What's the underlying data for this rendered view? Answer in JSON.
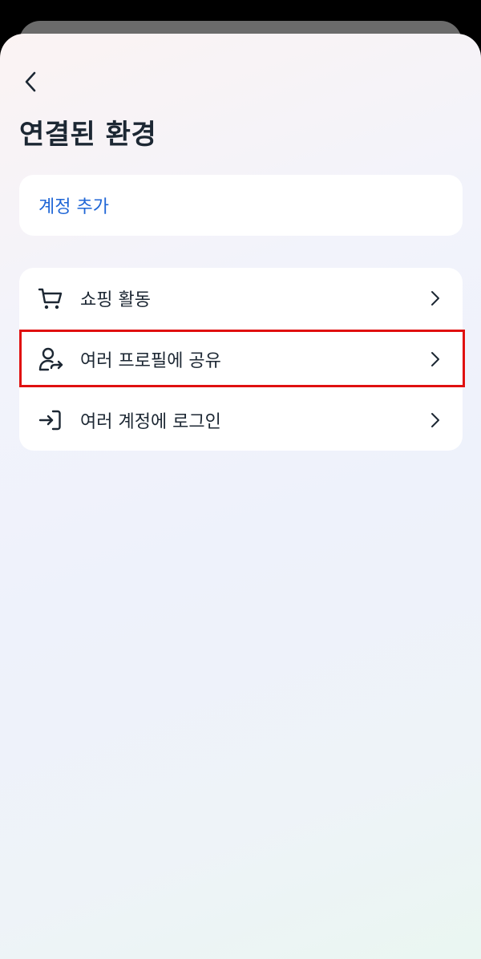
{
  "header": {
    "title": "연결된 환경"
  },
  "add_account": {
    "label": "계정 추가"
  },
  "list": {
    "items": [
      {
        "label": "쇼핑 활동",
        "icon": "shopping-cart-icon"
      },
      {
        "label": "여러 프로필에 공유",
        "icon": "profile-share-icon"
      },
      {
        "label": "여러 계정에 로그인",
        "icon": "login-icon"
      }
    ]
  },
  "colors": {
    "accent": "#1f66d6",
    "text": "#1c2733",
    "highlight": "#e01010"
  }
}
